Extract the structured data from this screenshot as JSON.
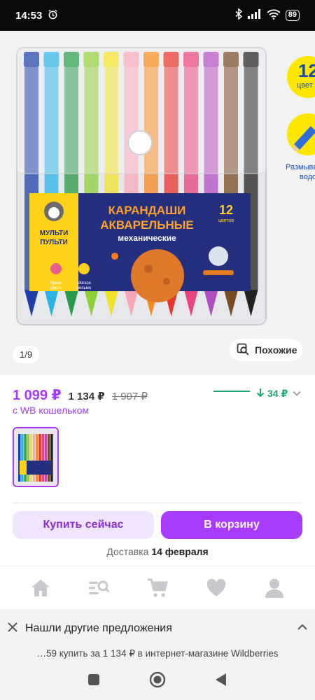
{
  "status_bar": {
    "time": "14:53",
    "battery": "89"
  },
  "gallery": {
    "counter": "1/9",
    "similar_label": "Похожие",
    "side_badge_number": "12",
    "side_badge_word": "цвет",
    "side_caption_1": "Размыва",
    "side_caption_2": "водо",
    "product_image": {
      "brand_1": "МУЛЬТИ",
      "brand_2": "ПУЛЬТИ",
      "title_1": "КАРАНДАШИ",
      "title_2": "АКВАРЕЛЬНЫЕ",
      "subtitle": "механические",
      "count": "12",
      "count_word": "цветов",
      "feature_1a": "Яркие",
      "feature_1b": "цвета",
      "feature_2a": "Мягкое",
      "feature_2b": "письмо"
    },
    "pencil_colors": [
      "#1f3fa8",
      "#2bb3e6",
      "#2a9a4a",
      "#8fcf3a",
      "#f2e12b",
      "#f6a8b8",
      "#f58a1f",
      "#e8342c",
      "#e8437f",
      "#b24fc0",
      "#7a4a22",
      "#222222"
    ]
  },
  "price": {
    "main": "1 099 ₽",
    "current": "1 134 ₽",
    "old": "1 907 ₽",
    "wallet_label": "с WB кошельком",
    "trend_value": "34 ₽",
    "accent": "#a73afd",
    "trend_color": "#1ea672"
  },
  "actions": {
    "buy_now": "Купить сейчас",
    "add_to_cart": "В корзину"
  },
  "delivery": {
    "label": "Доставка",
    "date": "14 февраля"
  },
  "bottom_nav": {
    "items": [
      "home-icon",
      "catalog-search-icon",
      "cart-icon",
      "heart-icon",
      "profile-icon"
    ]
  },
  "offer_banner": {
    "title": "Нашли другие предложения",
    "subtitle": "…59 купить за 1 134 ₽ в интернет-магазине Wildberries"
  }
}
